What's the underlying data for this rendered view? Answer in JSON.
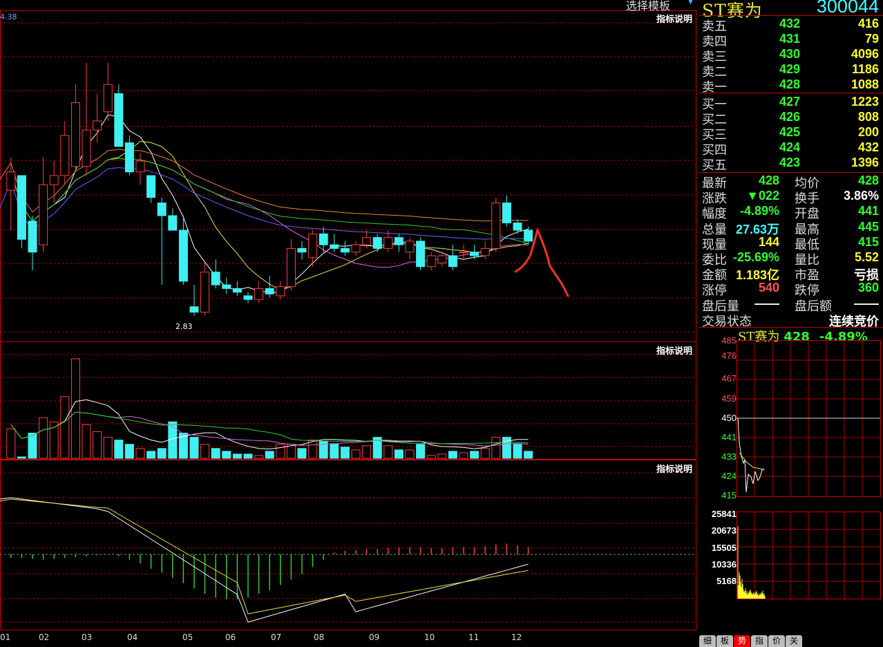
{
  "header": {
    "template_select": "选择模板",
    "stock_name": "ST赛为",
    "stock_code": "300044"
  },
  "main_chart": {
    "top_axis_label": "4.38",
    "low_label": "2.83",
    "indicator_label": "指标说明",
    "x_labels": [
      "01",
      "02",
      "03",
      "04",
      "05",
      "06",
      "07",
      "08",
      "09",
      "10",
      "11",
      "12"
    ]
  },
  "volume_panel": {
    "indicator_label": "指标说明"
  },
  "macd_panel": {
    "indicator_label": "指标说明"
  },
  "order_book": {
    "asks": [
      {
        "label": "卖五",
        "price": "432",
        "volume": "416"
      },
      {
        "label": "卖四",
        "price": "431",
        "volume": "79"
      },
      {
        "label": "卖三",
        "price": "430",
        "volume": "4096"
      },
      {
        "label": "卖二",
        "price": "429",
        "volume": "1186"
      },
      {
        "label": "卖一",
        "price": "428",
        "volume": "1088"
      }
    ],
    "bids": [
      {
        "label": "买一",
        "price": "427",
        "volume": "1223"
      },
      {
        "label": "买二",
        "price": "426",
        "volume": "808"
      },
      {
        "label": "买三",
        "price": "425",
        "volume": "200"
      },
      {
        "label": "买四",
        "price": "424",
        "volume": "432"
      },
      {
        "label": "买五",
        "price": "423",
        "volume": "1396"
      }
    ]
  },
  "quote": {
    "rows": [
      {
        "l1": "最新",
        "v1": "428",
        "c1": "green",
        "l2": "均价",
        "v2": "428",
        "c2": "green"
      },
      {
        "l1": "涨跌",
        "v1": "▼022",
        "c1": "green",
        "l2": "换手",
        "v2": "3.86%",
        "c2": "white"
      },
      {
        "l1": "幅度",
        "v1": "-4.89%",
        "c1": "green",
        "l2": "开盘",
        "v2": "441",
        "c2": "green"
      },
      {
        "l1": "总量",
        "v1": "27.63万",
        "c1": "cyan",
        "l2": "最高",
        "v2": "445",
        "c2": "green"
      },
      {
        "l1": "现量",
        "v1": "144",
        "c1": "yellow",
        "l2": "最低",
        "v2": "415",
        "c2": "green"
      },
      {
        "l1": "委比",
        "v1": "-25.69%",
        "c1": "green",
        "l2": "量比",
        "v2": "5.52",
        "c2": "yellow"
      },
      {
        "l1": "金额",
        "v1": "1.183亿",
        "c1": "yellow",
        "l2": "市盈",
        "v2": "亏损",
        "c2": "white"
      },
      {
        "l1": "涨停",
        "v1": "540",
        "c1": "red",
        "l2": "跌停",
        "v2": "360",
        "c2": "green"
      },
      {
        "l1": "盘后量",
        "v1": "——",
        "c1": "white",
        "l2": "盘后额",
        "v2": "——",
        "c2": "white"
      },
      {
        "l1": "交易状态",
        "v1": "",
        "c1": "white",
        "l2": "",
        "v2": "连续竞价",
        "c2": "white"
      }
    ]
  },
  "minute_chart": {
    "title_name": "ST赛为",
    "title_price": "428",
    "title_change": "-4.89%",
    "price_ticks": [
      "485",
      "476",
      "467",
      "459",
      "450",
      "441",
      "433",
      "424",
      "415"
    ],
    "volume_ticks": [
      "25841",
      "20673",
      "15505",
      "10336",
      "5168"
    ]
  },
  "tabs": [
    "细",
    "板",
    "势",
    "指",
    "价",
    "关"
  ],
  "active_tab": "势",
  "chart_data": {
    "type": "candlestick",
    "candles": [
      [
        3.52,
        3.7,
        3.3,
        3.62
      ],
      [
        3.6,
        3.6,
        3.2,
        3.25
      ],
      [
        3.35,
        3.38,
        3.08,
        3.18
      ],
      [
        3.22,
        3.7,
        3.18,
        3.55
      ],
      [
        3.55,
        3.68,
        3.45,
        3.6
      ],
      [
        3.6,
        3.9,
        3.55,
        3.82
      ],
      [
        3.65,
        4.1,
        3.62,
        4.0
      ],
      [
        3.65,
        4.22,
        3.6,
        3.85
      ],
      [
        3.85,
        4.05,
        3.78,
        3.9
      ],
      [
        3.95,
        4.22,
        3.9,
        4.1
      ],
      [
        4.05,
        4.1,
        3.76,
        3.76
      ],
      [
        3.78,
        3.82,
        3.6,
        3.62
      ],
      [
        3.62,
        3.72,
        3.55,
        3.68
      ],
      [
        3.6,
        3.6,
        3.45,
        3.48
      ],
      [
        3.45,
        3.48,
        3.0,
        3.38
      ],
      [
        3.38,
        3.42,
        3.3,
        3.3
      ],
      [
        3.3,
        3.38,
        3.0,
        3.02
      ],
      [
        2.88,
        3.0,
        2.83,
        2.85
      ],
      [
        2.85,
        3.12,
        2.83,
        3.07
      ],
      [
        3.07,
        3.14,
        2.98,
        3.0
      ],
      [
        3.0,
        3.04,
        2.95,
        2.98
      ],
      [
        2.98,
        3.02,
        2.94,
        2.96
      ],
      [
        2.94,
        2.96,
        2.9,
        2.92
      ],
      [
        2.92,
        3.02,
        2.9,
        2.98
      ],
      [
        2.98,
        3.05,
        2.93,
        2.95
      ],
      [
        2.94,
        3.02,
        2.92,
        2.99
      ],
      [
        2.99,
        3.25,
        2.97,
        3.2
      ],
      [
        3.2,
        3.24,
        3.14,
        3.18
      ],
      [
        3.15,
        3.3,
        3.1,
        3.28
      ],
      [
        3.28,
        3.32,
        3.18,
        3.22
      ],
      [
        3.22,
        3.28,
        3.18,
        3.2
      ],
      [
        3.2,
        3.24,
        3.16,
        3.18
      ],
      [
        3.18,
        3.24,
        3.16,
        3.22
      ],
      [
        3.22,
        3.3,
        3.2,
        3.26
      ],
      [
        3.26,
        3.28,
        3.18,
        3.2
      ],
      [
        3.2,
        3.3,
        3.18,
        3.26
      ],
      [
        3.26,
        3.28,
        3.18,
        3.22
      ],
      [
        3.18,
        3.26,
        3.14,
        3.24
      ],
      [
        3.24,
        3.26,
        3.08,
        3.1
      ],
      [
        3.1,
        3.18,
        3.08,
        3.16
      ],
      [
        3.12,
        3.18,
        3.1,
        3.16
      ],
      [
        3.16,
        3.22,
        3.08,
        3.1
      ],
      [
        3.18,
        3.22,
        3.14,
        3.18
      ],
      [
        3.18,
        3.22,
        3.14,
        3.16
      ],
      [
        3.16,
        3.24,
        3.14,
        3.2
      ],
      [
        3.2,
        3.48,
        3.18,
        3.45
      ],
      [
        3.45,
        3.49,
        3.32,
        3.34
      ],
      [
        3.34,
        3.36,
        3.28,
        3.3
      ],
      [
        3.3,
        3.32,
        3.22,
        3.24
      ]
    ],
    "volume": [
      42,
      2,
      36,
      58,
      52,
      88,
      142,
      48,
      38,
      30,
      26,
      20,
      14,
      10,
      14,
      52,
      36,
      30,
      20,
      14,
      10,
      6,
      6,
      4,
      10,
      20,
      20,
      14,
      26,
      24,
      20,
      16,
      12,
      18,
      30,
      18,
      12,
      12,
      20,
      4,
      6,
      10,
      8,
      10,
      14,
      30,
      30,
      20,
      10
    ],
    "macd_hist": [
      -4,
      -4,
      -5,
      -6,
      -5,
      -4,
      -3,
      -2,
      -1,
      0,
      -2,
      -6,
      -10,
      -16,
      -20,
      -26,
      -32,
      -38,
      -44,
      -48,
      -50,
      -50,
      -48,
      -44,
      -40,
      -34,
      -28,
      -22,
      -14,
      -6,
      2,
      4,
      5,
      6,
      6,
      7,
      8,
      8,
      8,
      7,
      7,
      8,
      8,
      8,
      9,
      11,
      12,
      10,
      8
    ],
    "ylim": [
      2.75,
      4.45
    ]
  }
}
